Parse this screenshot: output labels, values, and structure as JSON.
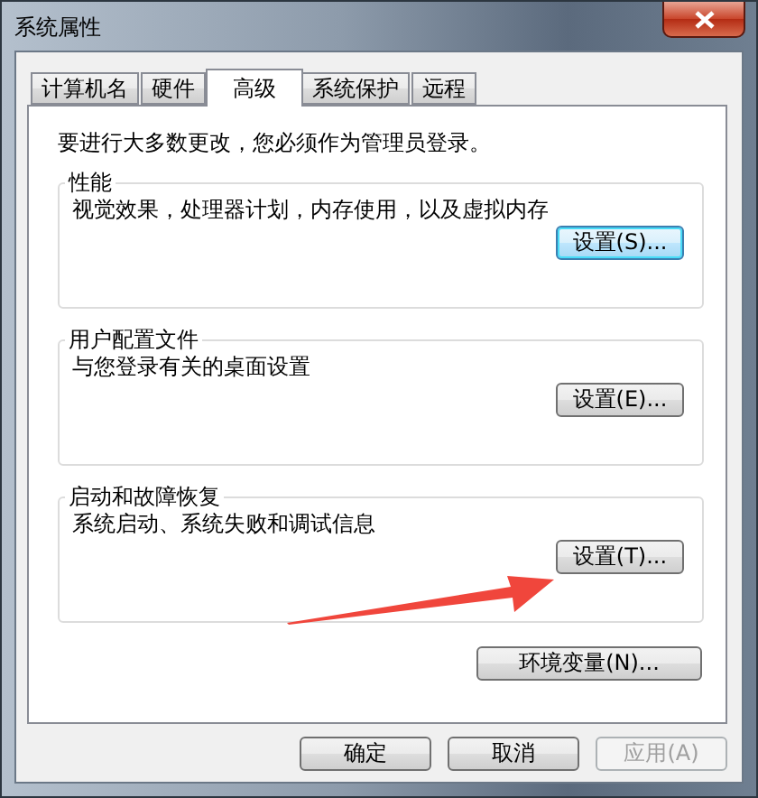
{
  "window": {
    "title": "系统属性"
  },
  "tabs": [
    {
      "label": "计算机名",
      "selected": false
    },
    {
      "label": "硬件",
      "selected": false
    },
    {
      "label": "高级",
      "selected": true
    },
    {
      "label": "系统保护",
      "selected": false
    },
    {
      "label": "远程",
      "selected": false
    }
  ],
  "notice": "要进行大多数更改，您必须作为管理员登录。",
  "groups": [
    {
      "title": "性能",
      "description": "视觉效果，处理器计划，内存使用，以及虚拟内存",
      "button": {
        "label": "设置(S)...",
        "focused": true
      }
    },
    {
      "title": "用户配置文件",
      "description": "与您登录有关的桌面设置",
      "button": {
        "label": "设置(E)...",
        "focused": false
      }
    },
    {
      "title": "启动和故障恢复",
      "description": "系统启动、系统失败和调试信息",
      "button": {
        "label": "设置(T)...",
        "focused": false
      }
    }
  ],
  "env_button": {
    "label": "环境变量(N)..."
  },
  "dialog_buttons": [
    {
      "label": "确定",
      "disabled": false
    },
    {
      "label": "取消",
      "disabled": false
    },
    {
      "label": "应用(A)",
      "disabled": true
    }
  ]
}
